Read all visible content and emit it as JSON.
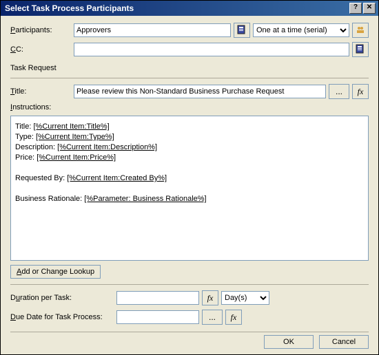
{
  "window": {
    "title": "Select Task Process Participants"
  },
  "participants": {
    "label": "Participants:",
    "value": "Approvers",
    "order_options": [
      "One at a time (serial)"
    ],
    "order_selected": "One at a time (serial)"
  },
  "cc": {
    "label": "CC:",
    "value": ""
  },
  "task_request": {
    "section_label": "Task Request",
    "title_label": "Title:",
    "title_value": "Please review this Non-Standard Business Purchase Request",
    "instructions_label": "Instructions:",
    "instructions": {
      "lines": [
        {
          "prefix": "Title: ",
          "token": "[%Current Item:Title%]"
        },
        {
          "prefix": "Type: ",
          "token": "[%Current Item:Type%]"
        },
        {
          "prefix": "Description: ",
          "token": "[%Current Item:Description%]"
        },
        {
          "prefix": "Price: ",
          "token": "[%Current Item:Price%]"
        },
        {
          "prefix": "",
          "token": ""
        },
        {
          "prefix": "Requested By: ",
          "token": "[%Current Item:Created By%]"
        },
        {
          "prefix": "",
          "token": ""
        },
        {
          "prefix": "Business Rationale: ",
          "token": "[%Parameter: Business Rationale%]"
        }
      ]
    },
    "lookup_button": "Add or Change Lookup"
  },
  "duration": {
    "label": "Duration per Task:",
    "value": "",
    "unit_options": [
      "Day(s)"
    ],
    "unit_selected": "Day(s)"
  },
  "due_date": {
    "label": "Due Date for Task Process:",
    "value": ""
  },
  "buttons": {
    "ellipsis": "...",
    "fx": "fx",
    "ok": "OK",
    "cancel": "Cancel"
  }
}
